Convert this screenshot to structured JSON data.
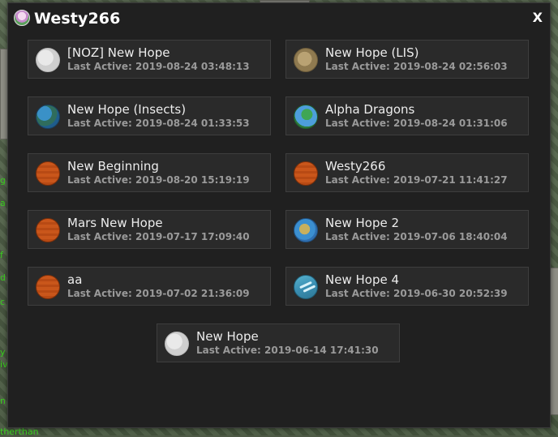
{
  "background": {
    "left_text_fragments": [
      "g",
      "a",
      "f",
      "d",
      "c",
      "y",
      "iv",
      "n"
    ],
    "bottom_text": "therthan"
  },
  "modal": {
    "title": "Westy266",
    "close_label": "X"
  },
  "colonies": [
    {
      "name": "[NOZ] New Hope",
      "last_active_label": "Last Active:",
      "last_active": "2019-08-24 03:48:13",
      "planet_icon": "moon-planet-icon"
    },
    {
      "name": "New Hope (LIS)",
      "last_active_label": "Last Active:",
      "last_active": "2019-08-24 02:56:03",
      "planet_icon": "asteroid-planet-icon"
    },
    {
      "name": "New Hope (Insects)",
      "last_active_label": "Last Active:",
      "last_active": "2019-08-24 01:33:53",
      "planet_icon": "insect-planet-icon"
    },
    {
      "name": "Alpha Dragons",
      "last_active_label": "Last Active:",
      "last_active": "2019-08-24 01:31:06",
      "planet_icon": "earth-planet-icon"
    },
    {
      "name": "New Beginning",
      "last_active_label": "Last Active:",
      "last_active": "2019-08-20 15:19:19",
      "planet_icon": "mars-planet-icon"
    },
    {
      "name": "Westy266",
      "last_active_label": "Last Active:",
      "last_active": "2019-07-21 11:41:27",
      "planet_icon": "mars-planet-icon"
    },
    {
      "name": "Mars New Hope",
      "last_active_label": "Last Active:",
      "last_active": "2019-07-17 17:09:40",
      "planet_icon": "mars-planet-icon"
    },
    {
      "name": "New Hope 2",
      "last_active_label": "Last Active:",
      "last_active": "2019-07-06 18:40:04",
      "planet_icon": "earth-planet-icon"
    },
    {
      "name": "aa",
      "last_active_label": "Last Active:",
      "last_active": "2019-07-02 21:36:09",
      "planet_icon": "mars-planet-icon"
    },
    {
      "name": "New Hope 4",
      "last_active_label": "Last Active:",
      "last_active": "2019-06-30 20:52:39",
      "planet_icon": "ocean-planet-icon"
    },
    {
      "name": "New Hope",
      "last_active_label": "Last Active:",
      "last_active": "2019-06-14 17:41:30",
      "planet_icon": "moon-planet-icon"
    }
  ]
}
